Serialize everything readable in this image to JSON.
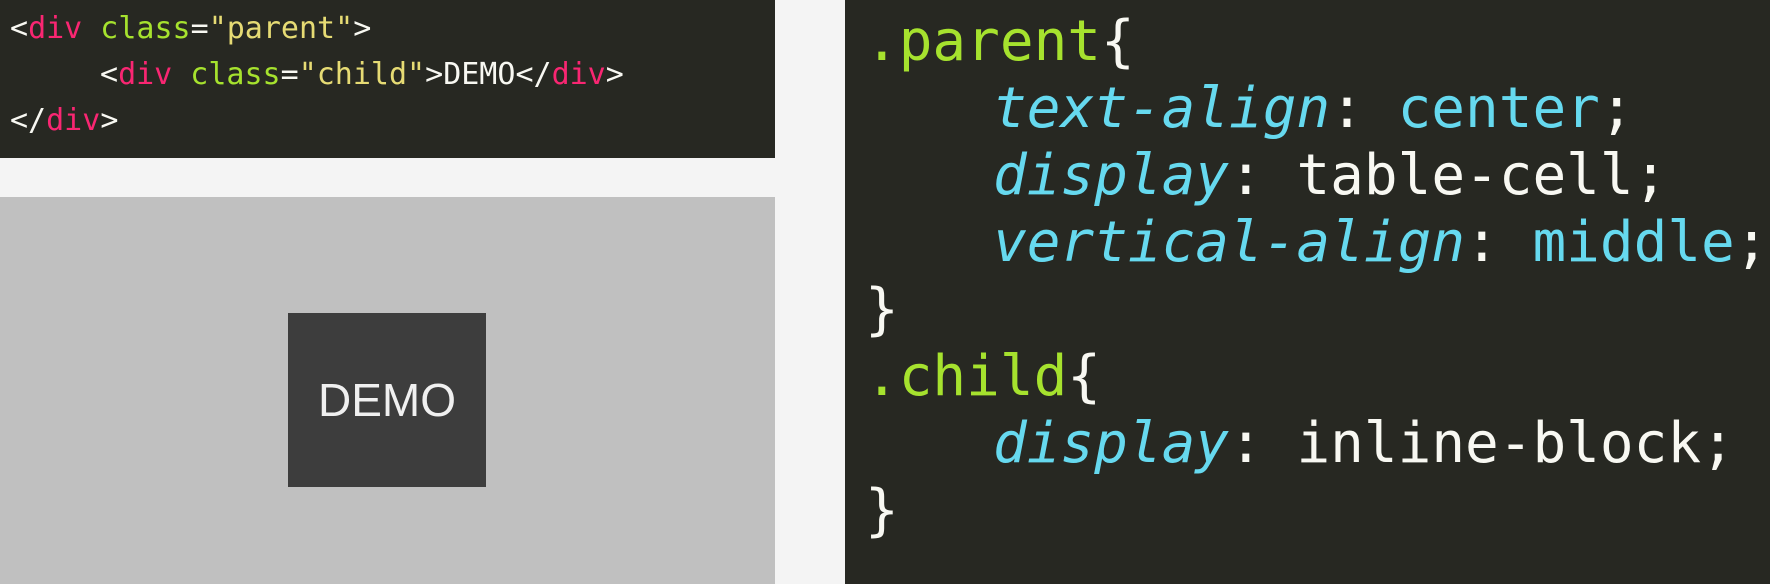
{
  "html_code": {
    "line1": {
      "open": "<",
      "tag": "div",
      "attr": " class",
      "eq": "=",
      "value": "\"parent\"",
      "close": ">"
    },
    "line2": {
      "open": "<",
      "tag": "div",
      "attr": " class",
      "eq": "=",
      "value": "\"child\"",
      "close": ">",
      "text": "DEMO",
      "end_open": "</",
      "end_tag": "div",
      "end_close": ">"
    },
    "line3": {
      "end_open": "</",
      "end_tag": "div",
      "end_close": ">"
    }
  },
  "preview": {
    "demo_text": "DEMO"
  },
  "css_code": {
    "parent_selector": ".parent",
    "parent_open": "{",
    "rules_parent": [
      {
        "prop": "text-align",
        "value": "center"
      },
      {
        "prop": "display",
        "value": "table-cell"
      },
      {
        "prop": "vertical-align",
        "value": "middle"
      }
    ],
    "parent_close": "}",
    "child_selector": ".child",
    "child_open": "{",
    "rules_child": [
      {
        "prop": "display",
        "value": "inline-block"
      }
    ],
    "child_close": "}",
    "colon": ":",
    "semicolon": ";"
  },
  "colors": {
    "editor_bg": "#272822",
    "tag": "#f92672",
    "attr": "#a6e22e",
    "string": "#e6db74",
    "property": "#66d9ef",
    "preview_bg": "#c0c0c0",
    "demo_box": "#3d3d3d"
  }
}
